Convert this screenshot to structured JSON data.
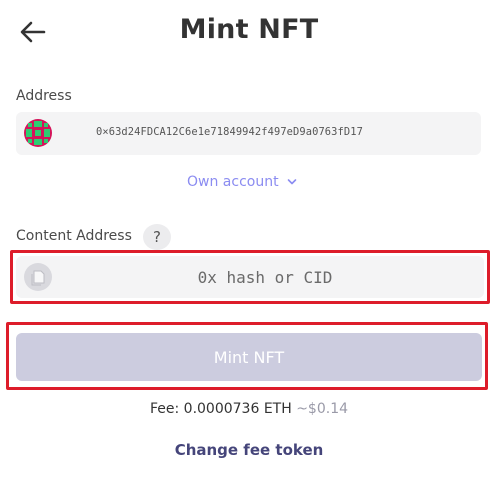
{
  "header": {
    "title": "Mint NFT",
    "back_icon": "arrow-left-icon"
  },
  "address": {
    "label": "Address",
    "value": "0×63d24FDCA12C6e1e71849942f497eD9a0763fD17",
    "avatar_icon": "identicon-avatar",
    "avatar_colors": [
      "#d4145a",
      "#2ecc71"
    ]
  },
  "own_account": {
    "label": "Own account",
    "icon": "chevron-down-icon",
    "color": "#8b8cf1"
  },
  "content": {
    "label": "Content Address",
    "help_label": "?",
    "placeholder": "0x hash or CID",
    "value": "",
    "icon": "document-icon"
  },
  "mint_button": {
    "label": "Mint NFT",
    "state": "disabled",
    "color": "#ccccdf"
  },
  "fee": {
    "prefix": "Fee:",
    "amount": "0.0000736 ETH",
    "usd": "~$0.14"
  },
  "change_fee": {
    "label": "Change fee token"
  },
  "highlight_color": "#dd1c2a"
}
